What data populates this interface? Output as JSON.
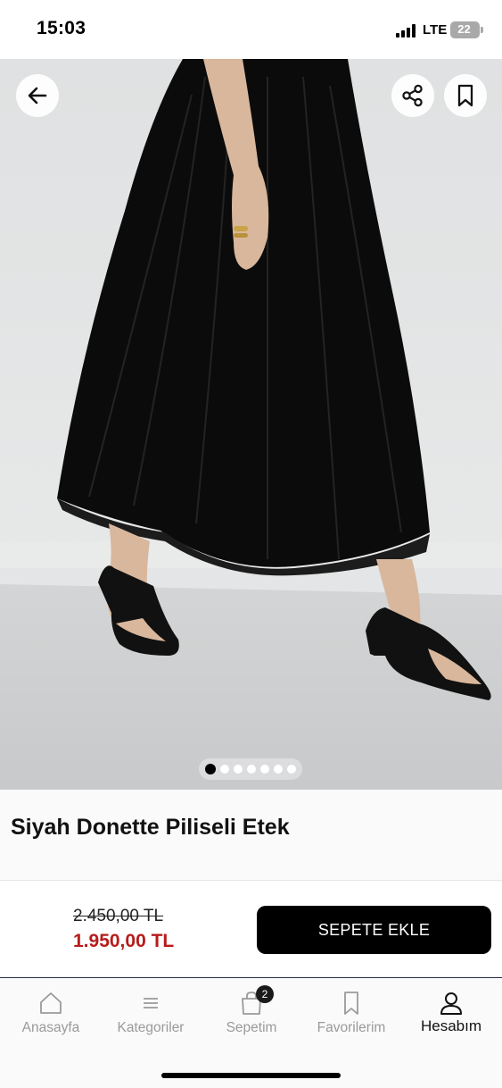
{
  "status_bar": {
    "time": "15:03",
    "network": "LTE",
    "battery": "22"
  },
  "product": {
    "title": "Siyah Donette Piliseli Etek",
    "old_price": "2.450,00 TL",
    "new_price": "1.950,00 TL",
    "image_count": 7,
    "active_image_index": 0
  },
  "actions": {
    "add_to_cart": "SEPETE EKLE"
  },
  "tab_bar": {
    "items": [
      {
        "label": "Anasayfa",
        "icon": "home-icon"
      },
      {
        "label": "Kategoriler",
        "icon": "menu-icon"
      },
      {
        "label": "Sepetim",
        "icon": "shopping-bag-icon",
        "badge": "2"
      },
      {
        "label": "Favorilerim",
        "icon": "bookmark-icon"
      },
      {
        "label": "Hesabım",
        "icon": "user-icon",
        "active": true
      }
    ]
  },
  "colors": {
    "accent_price": "#b71c1c",
    "button": "#000000",
    "inactive_tab": "#9a9a9a"
  }
}
